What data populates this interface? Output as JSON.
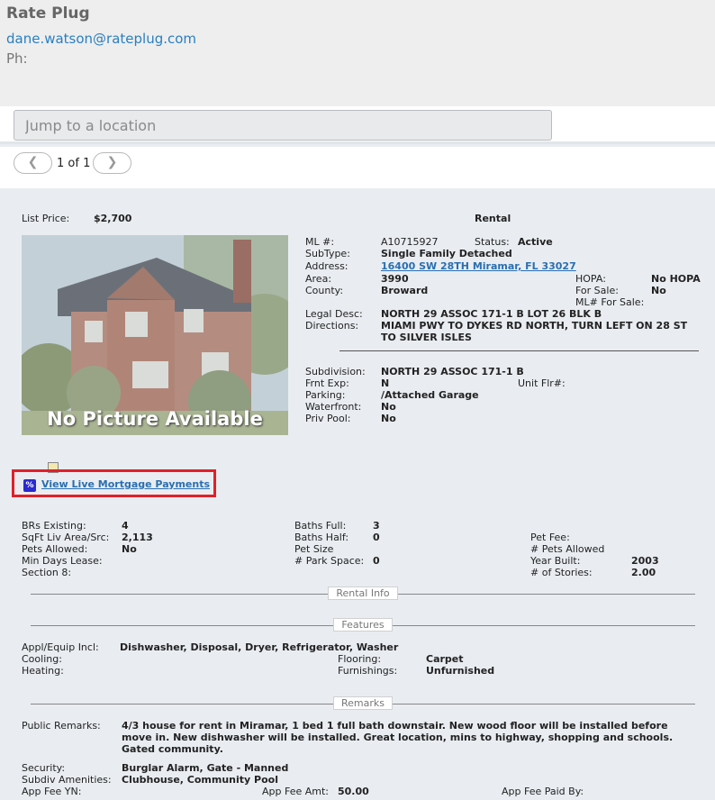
{
  "header": {
    "brand": "Rate Plug",
    "email": "dane.watson@rateplug.com",
    "phone_label": "Ph:"
  },
  "search": {
    "placeholder": "Jump to a location"
  },
  "pager": {
    "prev": "❮",
    "next": "❯",
    "count": "1 of 1"
  },
  "listing": {
    "list_price_label": "List Price:",
    "list_price": "$2,700",
    "type": "Rental",
    "photo_text": "No Picture Available",
    "ml_label": "ML #:",
    "ml": "A10715927",
    "status_label": "Status:",
    "status": "Active",
    "subtype_label": "SubType:",
    "subtype": "Single Family Detached",
    "address_label": "Address:",
    "address": "16400 SW 28TH Miramar, FL 33027",
    "area_label": "Area:",
    "area": "3990",
    "hopa_label": "HOPA:",
    "hopa": "No HOPA",
    "county_label": "County:",
    "county": "Broward",
    "forsale_label": "For Sale:",
    "forsale": "No",
    "mlforsale_label": "ML# For Sale:",
    "legal_label": "Legal Desc:",
    "legal": "NORTH 29 ASSOC 171-1 B LOT 26 BLK B",
    "directions_label": "Directions:",
    "directions_1": "MIAMI PWY TO DYKES RD NORTH, TURN LEFT ON 28 ST",
    "directions_2": "TO SILVER ISLES",
    "subdivision_label": "Subdivision:",
    "subdivision": "NORTH 29 ASSOC 171-1 B",
    "frnt_label": "Frnt Exp:",
    "frnt": "N",
    "unitflr_label": "Unit Flr#:",
    "parking_label": "Parking:",
    "parking": "/Attached Garage",
    "waterfront_label": "Waterfront:",
    "waterfront": "No",
    "privpool_label": "Priv Pool:",
    "privpool": "No"
  },
  "mortgage": {
    "icon": "%",
    "link": "View Live Mortgage Payments"
  },
  "details": {
    "brs_label": "BRs Existing:",
    "brs": "4",
    "sqft_label": "SqFt Liv Area/Src:",
    "sqft": "2,113",
    "pets_label": "Pets Allowed:",
    "pets": "No",
    "mindays_label": "Min Days Lease:",
    "section8_label": "Section 8:",
    "bathsfull_label": "Baths Full:",
    "bathsfull": "3",
    "bathshalf_label": "Baths Half:",
    "bathshalf": "0",
    "petsize_label": "Pet Size",
    "parkspace_label": "# Park Space:",
    "parkspace": "0",
    "petfee_label": "Pet Fee:",
    "numpets_label": "# Pets Allowed",
    "yearbuilt_label": "Year Built:",
    "yearbuilt": "2003",
    "stories_label": "# of Stories:",
    "stories": "2.00"
  },
  "sections": {
    "rental_info": "Rental Info",
    "features": "Features",
    "remarks": "Remarks"
  },
  "features": {
    "appl_label": "Appl/Equip Incl:",
    "appl": "Dishwasher, Disposal, Dryer, Refrigerator, Washer",
    "cooling_label": "Cooling:",
    "heating_label": "Heating:",
    "flooring_label": "Flooring:",
    "flooring": "Carpet",
    "furnishings_label": "Furnishings:",
    "furnishings": "Unfurnished"
  },
  "remarks": {
    "public_label": "Public Remarks:",
    "public_1": "4/3 house for rent in Miramar, 1 bed 1 full bath downstair. New wood floor will be installed before",
    "public_2": "move in. New dishwasher will be installed. Great location, mins to highway, shopping and schools.",
    "public_3": "Gated community.",
    "security_label": "Security:",
    "security": "Burglar Alarm, Gate - Manned",
    "amenities_label": "Subdiv Amenities:",
    "amenities": "Clubhouse, Community Pool",
    "appfee_yn_label": "App Fee YN:",
    "appfee_amt_label": "App Fee Amt:",
    "appfee_amt": "50.00",
    "appfee_paid_label": "App Fee Paid By:"
  }
}
